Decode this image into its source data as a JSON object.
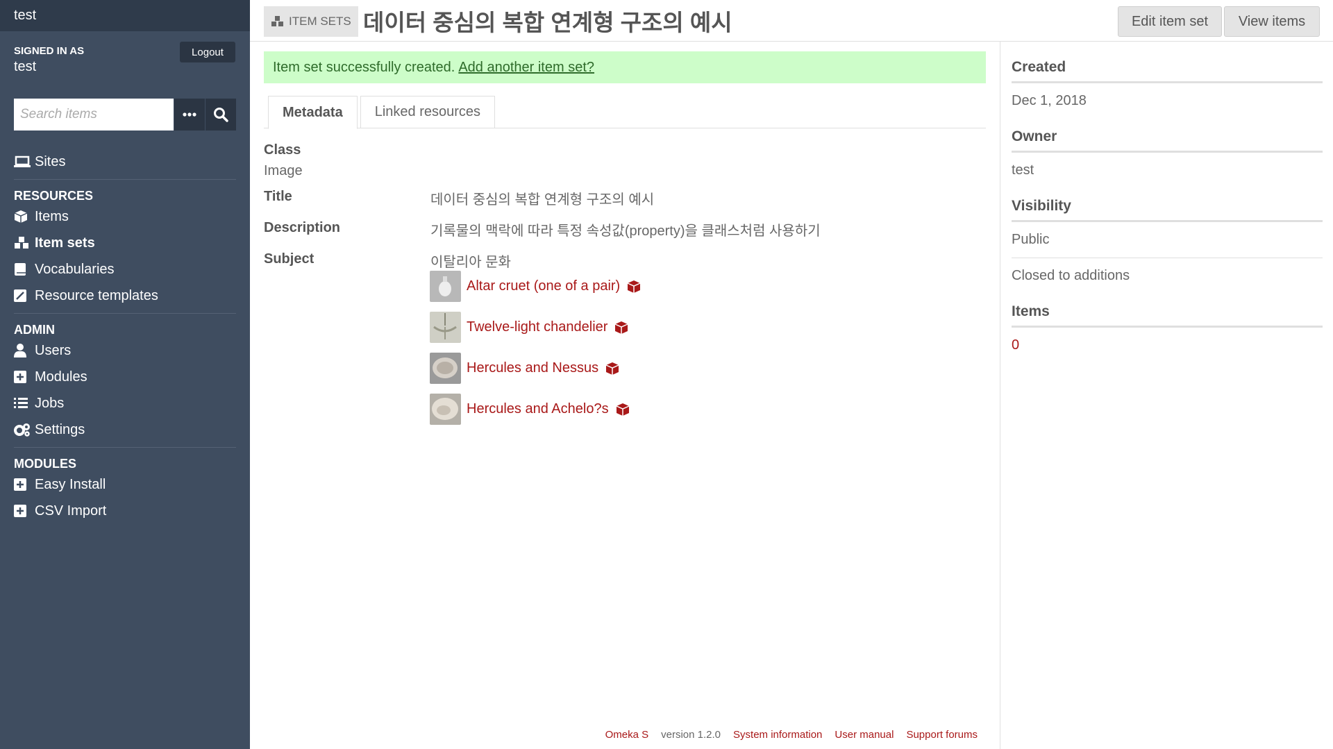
{
  "sidebar": {
    "site_name": "test",
    "signed_in_label": "SIGNED IN AS",
    "user": "test",
    "logout": "Logout",
    "search_placeholder": "Search items",
    "sites": "Sites",
    "resources_heading": "RESOURCES",
    "items": "Items",
    "item_sets": "Item sets",
    "vocabularies": "Vocabularies",
    "resource_templates": "Resource templates",
    "admin_heading": "ADMIN",
    "users": "Users",
    "modules": "Modules",
    "jobs": "Jobs",
    "settings": "Settings",
    "modules_heading": "MODULES",
    "easy_install": "Easy Install",
    "csv_import": "CSV Import"
  },
  "header": {
    "badge": "ITEM SETS",
    "title": "데이터 중심의 복합 연계형 구조의 예시",
    "edit": "Edit item set",
    "view": "View items"
  },
  "main": {
    "success_text": "Item set successfully created.",
    "success_link": "Add another item set?",
    "tab_metadata": "Metadata",
    "tab_linked": "Linked resources",
    "class_label": "Class",
    "class_value": "Image",
    "title_label": "Title",
    "title_value": "데이터 중심의 복합 연계형 구조의 예시",
    "description_label": "Description",
    "description_value": "기록물의 맥락에 따라 특정 속성값(property)을 클래스처럼 사용하기",
    "subject_label": "Subject",
    "subject_value": "이탈리아 문화",
    "resources": [
      {
        "name": "Altar cruet (one of a pair)"
      },
      {
        "name": "Twelve-light chandelier"
      },
      {
        "name": "Hercules and Nessus"
      },
      {
        "name": "Hercules and Achelo?s"
      }
    ]
  },
  "aside": {
    "created_label": "Created",
    "created_value": "Dec 1, 2018",
    "owner_label": "Owner",
    "owner_value": "test",
    "visibility_label": "Visibility",
    "visibility_value": "Public",
    "additions_value": "Closed to additions",
    "items_label": "Items",
    "items_value": "0"
  },
  "footer": {
    "omeka": "Omeka S",
    "version": "version 1.2.0",
    "system_info": "System information",
    "user_manual": "User manual",
    "support": "Support forums"
  },
  "colors": {
    "sidebar": "#3f4d60",
    "accent": "#a91919",
    "success_bg": "#cdfdc9"
  }
}
